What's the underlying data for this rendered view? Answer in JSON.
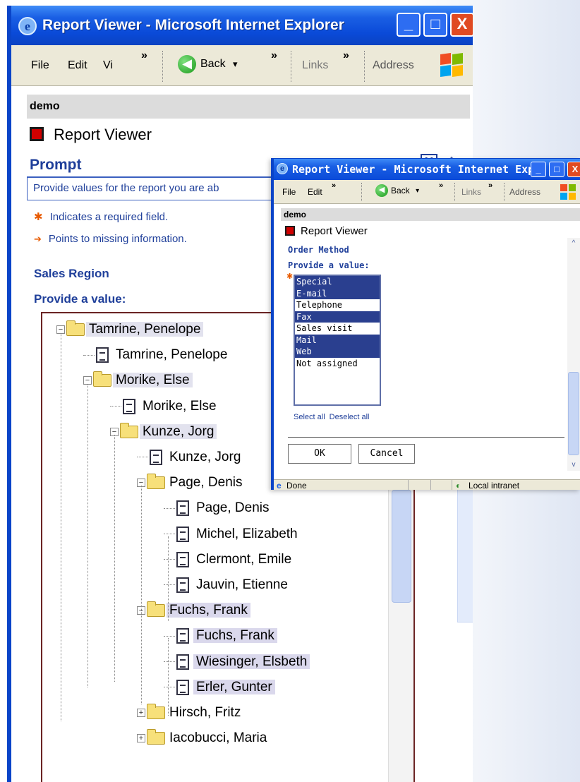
{
  "main_window": {
    "title": "Report Viewer - Microsoft Internet Explorer",
    "controls": {
      "minimize": "_",
      "maximize": "□",
      "close": "X"
    },
    "menu": {
      "file": "File",
      "edit": "Edit",
      "view": "Vi",
      "chevron": "»",
      "back": "Back",
      "back_dropdown": "▾",
      "links": "Links",
      "address": "Address"
    },
    "demo_label": "demo",
    "report_heading": "Report Viewer",
    "prompt_title": "Prompt",
    "close_glyph": "X",
    "collapse_glyph": "^",
    "prompt_description": "Provide values for the report you are ab",
    "legend": {
      "required_marker": "✱",
      "required_text": "Indicates a required field.",
      "missing_marker": "➔",
      "missing_text": "Points to missing information."
    },
    "section_title": "Sales Region",
    "provide_value": "Provide a value:",
    "tree": [
      {
        "label": "Tamrine, Penelope",
        "type": "folder",
        "toggle": "−",
        "hl": "hl2"
      },
      {
        "label": "Tamrine, Penelope",
        "type": "doc"
      },
      {
        "label": "Morike, Else",
        "type": "folder",
        "toggle": "−",
        "hl": "hl2"
      },
      {
        "label": "Morike, Else",
        "type": "doc"
      },
      {
        "label": "Kunze, Jorg",
        "type": "folder",
        "toggle": "−",
        "hl": "hl2"
      },
      {
        "label": "Kunze, Jorg",
        "type": "doc"
      },
      {
        "label": "Page, Denis",
        "type": "folder",
        "toggle": "−"
      },
      {
        "label": "Page, Denis",
        "type": "doc"
      },
      {
        "label": "Michel, Elizabeth",
        "type": "doc"
      },
      {
        "label": "Clermont, Emile",
        "type": "doc"
      },
      {
        "label": "Jauvin, Etienne",
        "type": "doc"
      },
      {
        "label": "Fuchs, Frank",
        "type": "folder",
        "toggle": "−",
        "hl": "hl"
      },
      {
        "label": "Fuchs, Frank",
        "type": "doc",
        "hl": "hl"
      },
      {
        "label": "Wiesinger, Elsbeth",
        "type": "doc",
        "hl": "hl"
      },
      {
        "label": "Erler, Gunter",
        "type": "doc",
        "hl": "hl"
      },
      {
        "label": "Hirsch, Fritz",
        "type": "folder",
        "toggle": "+"
      },
      {
        "label": "Iacobucci, Maria",
        "type": "folder",
        "toggle": "+"
      }
    ]
  },
  "popup_window": {
    "title": "Report Viewer - Microsoft Internet Expl...",
    "controls": {
      "minimize": "_",
      "maximize": "□",
      "close": "X"
    },
    "menu": {
      "file": "File",
      "edit": "Edit",
      "chevron": "»",
      "back": "Back",
      "back_dropdown": "▾",
      "links": "Links",
      "address": "Address"
    },
    "demo_label": "demo",
    "report_heading": "Report Viewer",
    "section_title": "Order Method",
    "provide_value": "Provide a value:",
    "required_marker": "✱",
    "options": [
      {
        "label": "Special",
        "selected": true
      },
      {
        "label": "E-mail",
        "selected": true
      },
      {
        "label": "Telephone",
        "selected": false
      },
      {
        "label": "Fax",
        "selected": true
      },
      {
        "label": "Sales visit",
        "selected": false
      },
      {
        "label": "Mail",
        "selected": true
      },
      {
        "label": "Web",
        "selected": true
      },
      {
        "label": "Not assigned",
        "selected": false
      }
    ],
    "select_all": "Select all",
    "deselect_all": "Deselect all",
    "ok_button": "OK",
    "cancel_button": "Cancel",
    "scroll": {
      "up": "^",
      "down": "v"
    },
    "status": {
      "done_icon": "e",
      "done": "Done",
      "zone_icon": "◐",
      "zone": "Local intranet"
    }
  }
}
